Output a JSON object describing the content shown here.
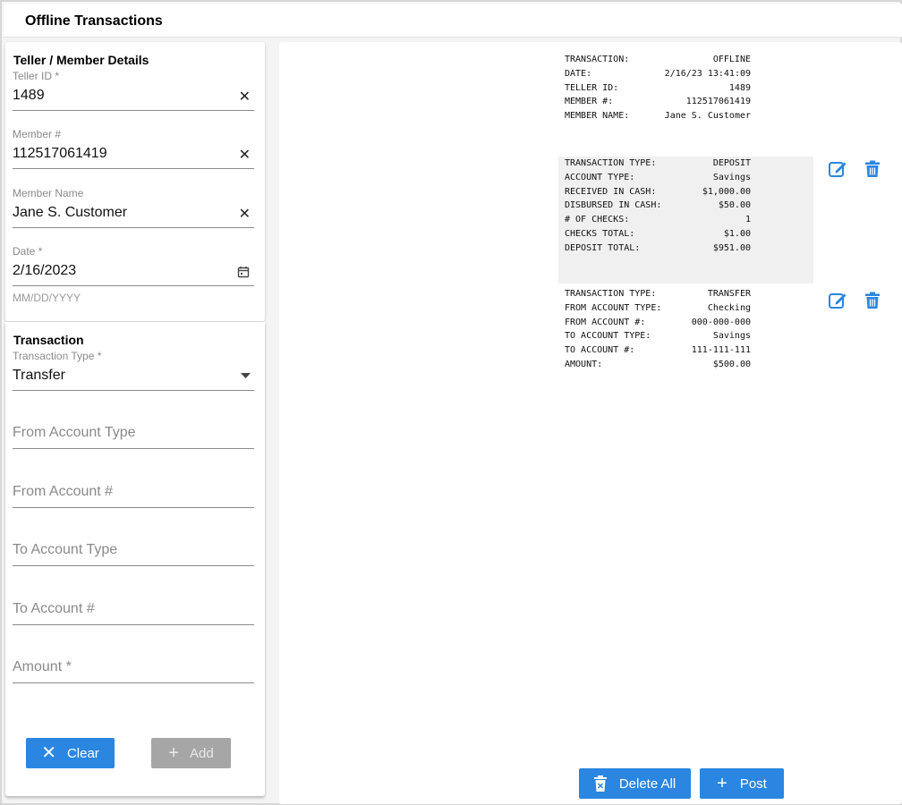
{
  "app": {
    "title": "Offline Transactions"
  },
  "teller_section": {
    "title": "Teller / Member Details",
    "teller_id": {
      "label": "Teller ID *",
      "value": "1489"
    },
    "member_number": {
      "label": "Member #",
      "value": "112517061419"
    },
    "member_name": {
      "label": "Member Name",
      "value": "Jane S. Customer"
    },
    "date": {
      "label": "Date *",
      "value": "2/16/2023",
      "helper": "MM/DD/YYYY"
    }
  },
  "transaction_section": {
    "title": "Transaction",
    "transaction_type": {
      "label": "Transaction Type *",
      "value": "Transfer"
    },
    "from_account_type": {
      "placeholder": "From Account Type"
    },
    "from_account_number": {
      "placeholder": "From Account #"
    },
    "to_account_type": {
      "placeholder": "To Account Type"
    },
    "to_account_number": {
      "placeholder": "To Account #"
    },
    "amount": {
      "placeholder": "Amount *"
    },
    "clear_label": "Clear",
    "add_label": "Add"
  },
  "receipt": {
    "header": [
      {
        "k": "TRANSACTION:",
        "v": "OFFLINE"
      },
      {
        "k": "DATE:",
        "v": "2/16/23 13:41:09"
      },
      {
        "k": "TELLER ID:",
        "v": "1489"
      },
      {
        "k": "MEMBER #:",
        "v": "112517061419"
      },
      {
        "k": "MEMBER NAME:",
        "v": "Jane S. Customer"
      }
    ],
    "transactions": [
      {
        "rows": [
          {
            "k": "TRANSACTION TYPE:",
            "v": "DEPOSIT"
          },
          {
            "k": "ACCOUNT TYPE:",
            "v": "Savings"
          },
          {
            "k": "RECEIVED IN CASH:",
            "v": "$1,000.00"
          },
          {
            "k": "DISBURSED IN CASH:",
            "v": "$50.00"
          },
          {
            "k": "# OF CHECKS:",
            "v": "1"
          },
          {
            "k": "CHECKS TOTAL:",
            "v": "$1.00"
          },
          {
            "k": "DEPOSIT TOTAL:",
            "v": "$951.00"
          }
        ]
      },
      {
        "rows": [
          {
            "k": "TRANSACTION TYPE:",
            "v": "TRANSFER"
          },
          {
            "k": "FROM ACCOUNT TYPE:",
            "v": "Checking"
          },
          {
            "k": "FROM ACCOUNT #:",
            "v": "000-000-000"
          },
          {
            "k": "TO ACCOUNT TYPE:",
            "v": "Savings"
          },
          {
            "k": "TO ACCOUNT #:",
            "v": "111-111-111"
          },
          {
            "k": "AMOUNT:",
            "v": "$500.00"
          }
        ]
      }
    ],
    "delete_all_label": "Delete All",
    "post_label": "Post"
  },
  "icons": {
    "clear_field": "close-icon",
    "date_picker": "calendar-icon",
    "dropdown": "caret-down-icon",
    "edit": "edit-icon",
    "delete": "trash-icon",
    "add": "plus-icon",
    "clear": "close-icon"
  },
  "colors": {
    "accent": "#2a86e0",
    "disabled": "#a6a6a6",
    "shaded_row": "#f0f0f0"
  }
}
